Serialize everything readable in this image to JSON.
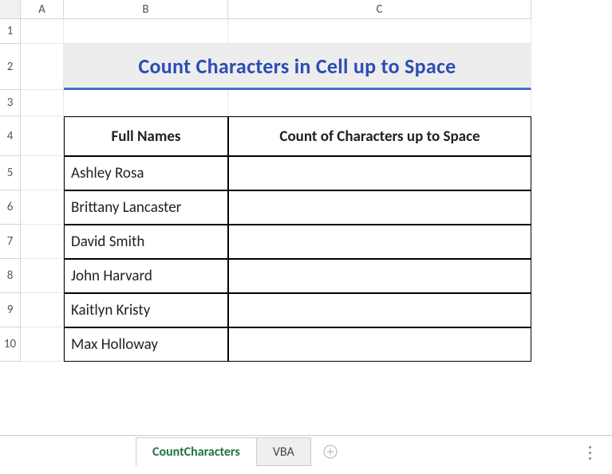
{
  "columns": {
    "A": "A",
    "B": "B",
    "C": "C"
  },
  "rows": {
    "1": "1",
    "2": "2",
    "3": "3",
    "4": "4",
    "5": "5",
    "6": "6",
    "7": "7",
    "8": "8",
    "9": "9",
    "10": "10"
  },
  "title": "Count Characters in Cell up to Space",
  "table": {
    "header_b": "Full Names",
    "header_c": "Count of Characters up to Space",
    "data": [
      {
        "name": "Ashley Rosa",
        "count": ""
      },
      {
        "name": "Brittany Lancaster",
        "count": ""
      },
      {
        "name": "David Smith",
        "count": ""
      },
      {
        "name": "John Harvard",
        "count": ""
      },
      {
        "name": "Kaitlyn Kristy",
        "count": ""
      },
      {
        "name": "Max Holloway",
        "count": ""
      }
    ]
  },
  "tabs": {
    "active": "CountCharacters",
    "other": "VBA"
  },
  "chart_data": {
    "type": "table",
    "title": "Count Characters in Cell up to Space",
    "columns": [
      "Full Names",
      "Count of Characters up to Space"
    ],
    "rows": [
      [
        "Ashley Rosa",
        ""
      ],
      [
        "Brittany Lancaster",
        ""
      ],
      [
        "David Smith",
        ""
      ],
      [
        "John Harvard",
        ""
      ],
      [
        "Kaitlyn Kristy",
        ""
      ],
      [
        "Max Holloway",
        ""
      ]
    ]
  }
}
